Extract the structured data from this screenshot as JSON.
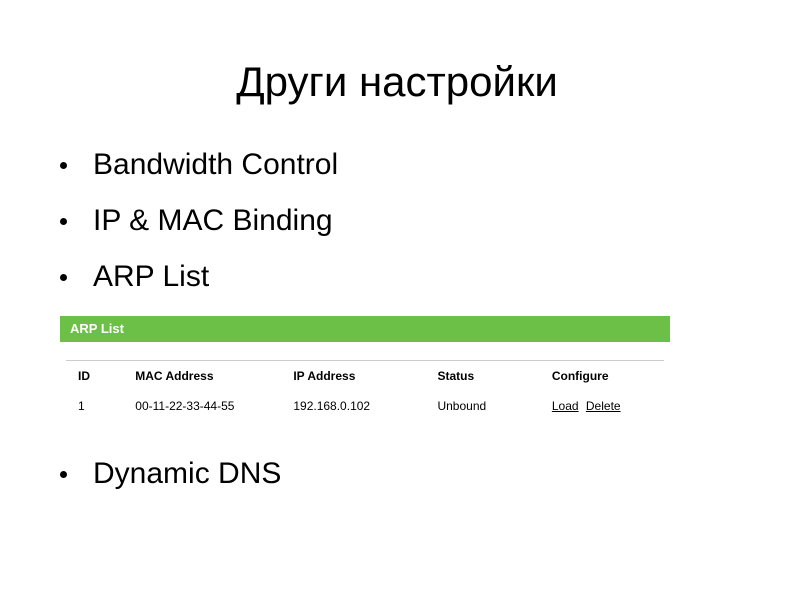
{
  "title": "Други настройки",
  "bullets": {
    "bandwidth": "Bandwidth Control",
    "ipmac": "IP & MAC Binding",
    "arp": "ARP List",
    "ddns": "Dynamic DNS"
  },
  "arp": {
    "header": "ARP List",
    "columns": {
      "id": "ID",
      "mac": "MAC Address",
      "ip": "IP Address",
      "status": "Status",
      "configure": "Configure"
    },
    "rows": [
      {
        "id": "1",
        "mac": "00-11-22-33-44-55",
        "ip": "192.168.0.102",
        "status": "Unbound",
        "load": "Load",
        "delete": "Delete"
      }
    ]
  }
}
